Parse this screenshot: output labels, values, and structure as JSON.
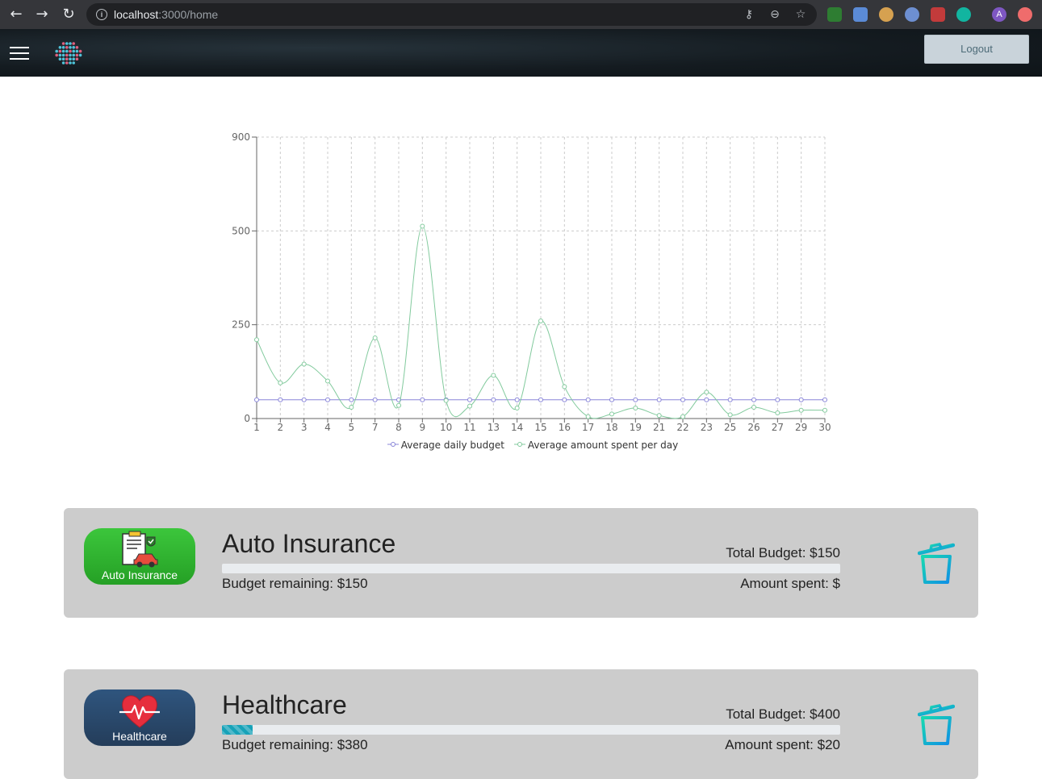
{
  "browser": {
    "url_host": "localhost",
    "url_rest": ":3000/home",
    "profile_initial": "A"
  },
  "navbar": {
    "logout_label": "Logout"
  },
  "chart_data": {
    "type": "line",
    "categories": [
      "1",
      "2",
      "3",
      "4",
      "5",
      "7",
      "8",
      "9",
      "10",
      "11",
      "13",
      "14",
      "15",
      "16",
      "17",
      "18",
      "19",
      "21",
      "22",
      "23",
      "25",
      "26",
      "27",
      "29",
      "30"
    ],
    "y_ticks": [
      0,
      250,
      500,
      900
    ],
    "y_tick_positions": [
      0,
      250,
      500,
      750
    ],
    "ylim": [
      0,
      900
    ],
    "grid": true,
    "legend_position": "bottom",
    "series": [
      {
        "name": "Average daily budget",
        "color": "#8884d8",
        "values": [
          50,
          50,
          50,
          50,
          50,
          50,
          50,
          50,
          50,
          50,
          50,
          50,
          50,
          50,
          50,
          50,
          50,
          50,
          50,
          50,
          50,
          50,
          50,
          50,
          50
        ]
      },
      {
        "name": "Average amount spent per day",
        "color": "#82ca9d",
        "values": [
          210,
          95,
          145,
          100,
          30,
          215,
          35,
          520,
          48,
          33,
          115,
          28,
          260,
          85,
          5,
          12,
          28,
          8,
          5,
          70,
          10,
          30,
          15,
          22,
          22
        ]
      }
    ]
  },
  "cards": [
    {
      "title": "Auto Insurance",
      "badge_label": "Auto Insurance",
      "badge_color": "#2db52d",
      "total": "Total Budget: $150",
      "remaining": "Budget remaining: $150",
      "spent": "Amount spent: $",
      "progress": 0
    },
    {
      "title": "Healthcare",
      "badge_label": "Healthcare",
      "badge_color": "#2c4a6e",
      "total": "Total Budget: $400",
      "remaining": "Budget remaining: $380",
      "spent": "Amount spent: $20",
      "progress": 0.05
    }
  ]
}
